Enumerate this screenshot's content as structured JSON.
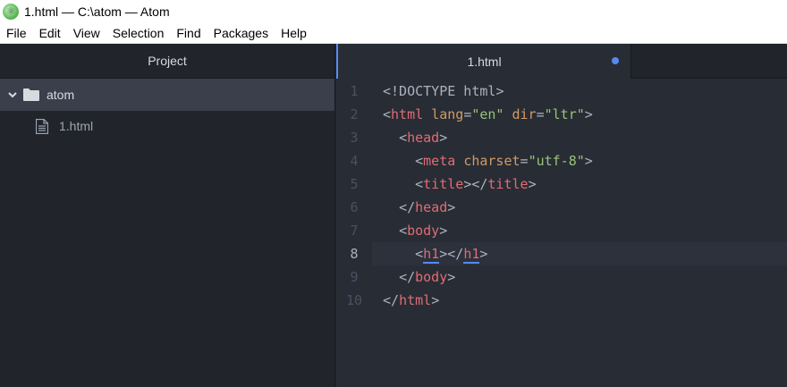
{
  "window": {
    "title": "1.html — C:\\atom — Atom",
    "icon": "atom-app-icon"
  },
  "menu": [
    "File",
    "Edit",
    "View",
    "Selection",
    "Find",
    "Packages",
    "Help"
  ],
  "sidebar": {
    "header": "Project",
    "root": {
      "label": "atom",
      "icon": "folder-icon",
      "expanded": true
    },
    "files": [
      {
        "label": "1.html",
        "icon": "file-text-icon"
      }
    ]
  },
  "editor": {
    "tab": {
      "label": "1.html",
      "modified": true
    },
    "active_line": 8,
    "line_numbers": [
      "1",
      "2",
      "3",
      "4",
      "5",
      "6",
      "7",
      "8",
      "9",
      "10"
    ],
    "lines": [
      "<!DOCTYPE html>",
      "<html lang=\"en\" dir=\"ltr\">",
      "  <head>",
      "    <meta charset=\"utf-8\">",
      "    <title></title>",
      "  </head>",
      "  <body>",
      "    <h1></h1>",
      "  </body>",
      "</html>"
    ]
  },
  "colors": {
    "tag": "#e06c75",
    "attribute": "#d19a66",
    "string": "#98c379",
    "punctuation": "#abb2bf",
    "accent": "#568af2"
  }
}
